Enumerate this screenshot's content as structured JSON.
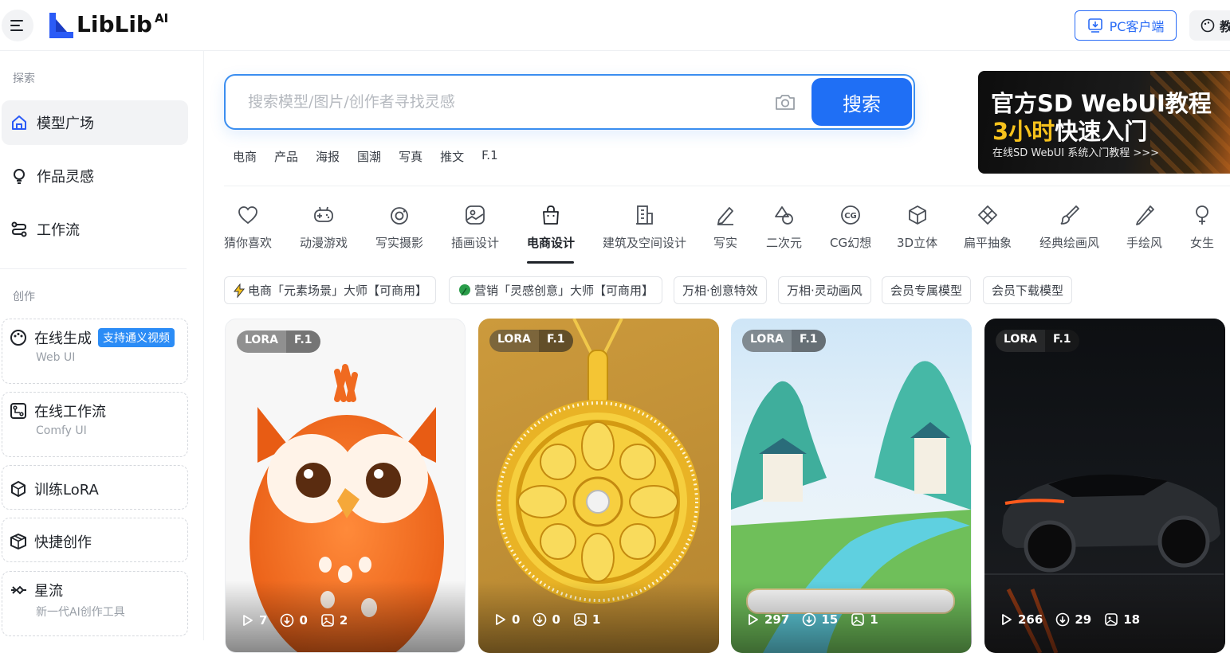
{
  "header": {
    "logo_text": "LibLib",
    "logo_sup": "AI",
    "pc_client_label": "PC客户端",
    "edu_label": "教"
  },
  "sidebar": {
    "explore_label": "探索",
    "explore_items": [
      {
        "label": "模型广场",
        "icon": "home-icon",
        "active": true
      },
      {
        "label": "作品灵感",
        "icon": "bulb-icon",
        "active": false
      },
      {
        "label": "工作流",
        "icon": "workflow-icon",
        "active": false
      }
    ],
    "create_label": "创作",
    "create_items": [
      {
        "label": "在线生成",
        "badge": "支持通义视频",
        "sub": "Web UI",
        "icon": "palette-icon"
      },
      {
        "label": "在线工作流",
        "sub": "Comfy UI",
        "icon": "flow-icon"
      },
      {
        "label": "训练LoRA",
        "icon": "cube-icon"
      },
      {
        "label": "快捷创作",
        "icon": "box-icon"
      },
      {
        "label": "星流",
        "sub": "新一代AI创作工具",
        "icon": "star-flow-icon"
      }
    ]
  },
  "search": {
    "placeholder": "搜索模型/图片/创作者寻找灵感",
    "button_label": "搜索",
    "hot_tags": [
      "电商",
      "产品",
      "海报",
      "国潮",
      "写真",
      "推文",
      "F.1"
    ]
  },
  "banner": {
    "line1": "官方SD WebUI教程",
    "line2_highlight": "3小时",
    "line2_rest": "快速入门",
    "line3": "在线SD WebUI 系统入门教程 >>>"
  },
  "categories": [
    {
      "label": "猜你喜欢",
      "icon": "heart-icon"
    },
    {
      "label": "动漫游戏",
      "icon": "gamepad-icon"
    },
    {
      "label": "写实摄影",
      "icon": "camera-icon"
    },
    {
      "label": "插画设计",
      "icon": "image-icon"
    },
    {
      "label": "电商设计",
      "icon": "shopping-bag-icon",
      "active": true
    },
    {
      "label": "建筑及空间设计",
      "icon": "building-icon"
    },
    {
      "label": "写实",
      "icon": "pen-icon"
    },
    {
      "label": "二次元",
      "icon": "shapes-icon"
    },
    {
      "label": "CG幻想",
      "icon": "cg-icon"
    },
    {
      "label": "3D立体",
      "icon": "cube-3d-icon"
    },
    {
      "label": "扁平抽象",
      "icon": "flat-icon"
    },
    {
      "label": "经典绘画风",
      "icon": "brush-icon"
    },
    {
      "label": "手绘风",
      "icon": "pencil-icon"
    },
    {
      "label": "女生",
      "icon": "female-icon"
    }
  ],
  "chips": [
    {
      "label": "电商「元素场景」大师【可商用】",
      "icon": "lightning-icon"
    },
    {
      "label": "营销「灵感创意」大师【可商用】",
      "icon": "leaf-icon"
    },
    {
      "label": "万相·创意特效"
    },
    {
      "label": "万相·灵动画风"
    },
    {
      "label": "会员专属模型"
    },
    {
      "label": "会员下载模型"
    }
  ],
  "cards": [
    {
      "type": "LORA",
      "base": "F.1",
      "runs": "7",
      "downloads": "0",
      "images": "2",
      "subject": "owl"
    },
    {
      "type": "LORA",
      "base": "F.1",
      "runs": "0",
      "downloads": "0",
      "images": "1",
      "subject": "pendant"
    },
    {
      "type": "LORA",
      "base": "F.1",
      "runs": "297",
      "downloads": "15",
      "images": "1",
      "subject": "landscape"
    },
    {
      "type": "LORA",
      "base": "F.1",
      "runs": "266",
      "downloads": "29",
      "images": "18",
      "subject": "car"
    }
  ],
  "colors": {
    "accent": "#1f6ff5",
    "badge": "#2b8cf6",
    "banner_highlight": "#f7c21c"
  }
}
